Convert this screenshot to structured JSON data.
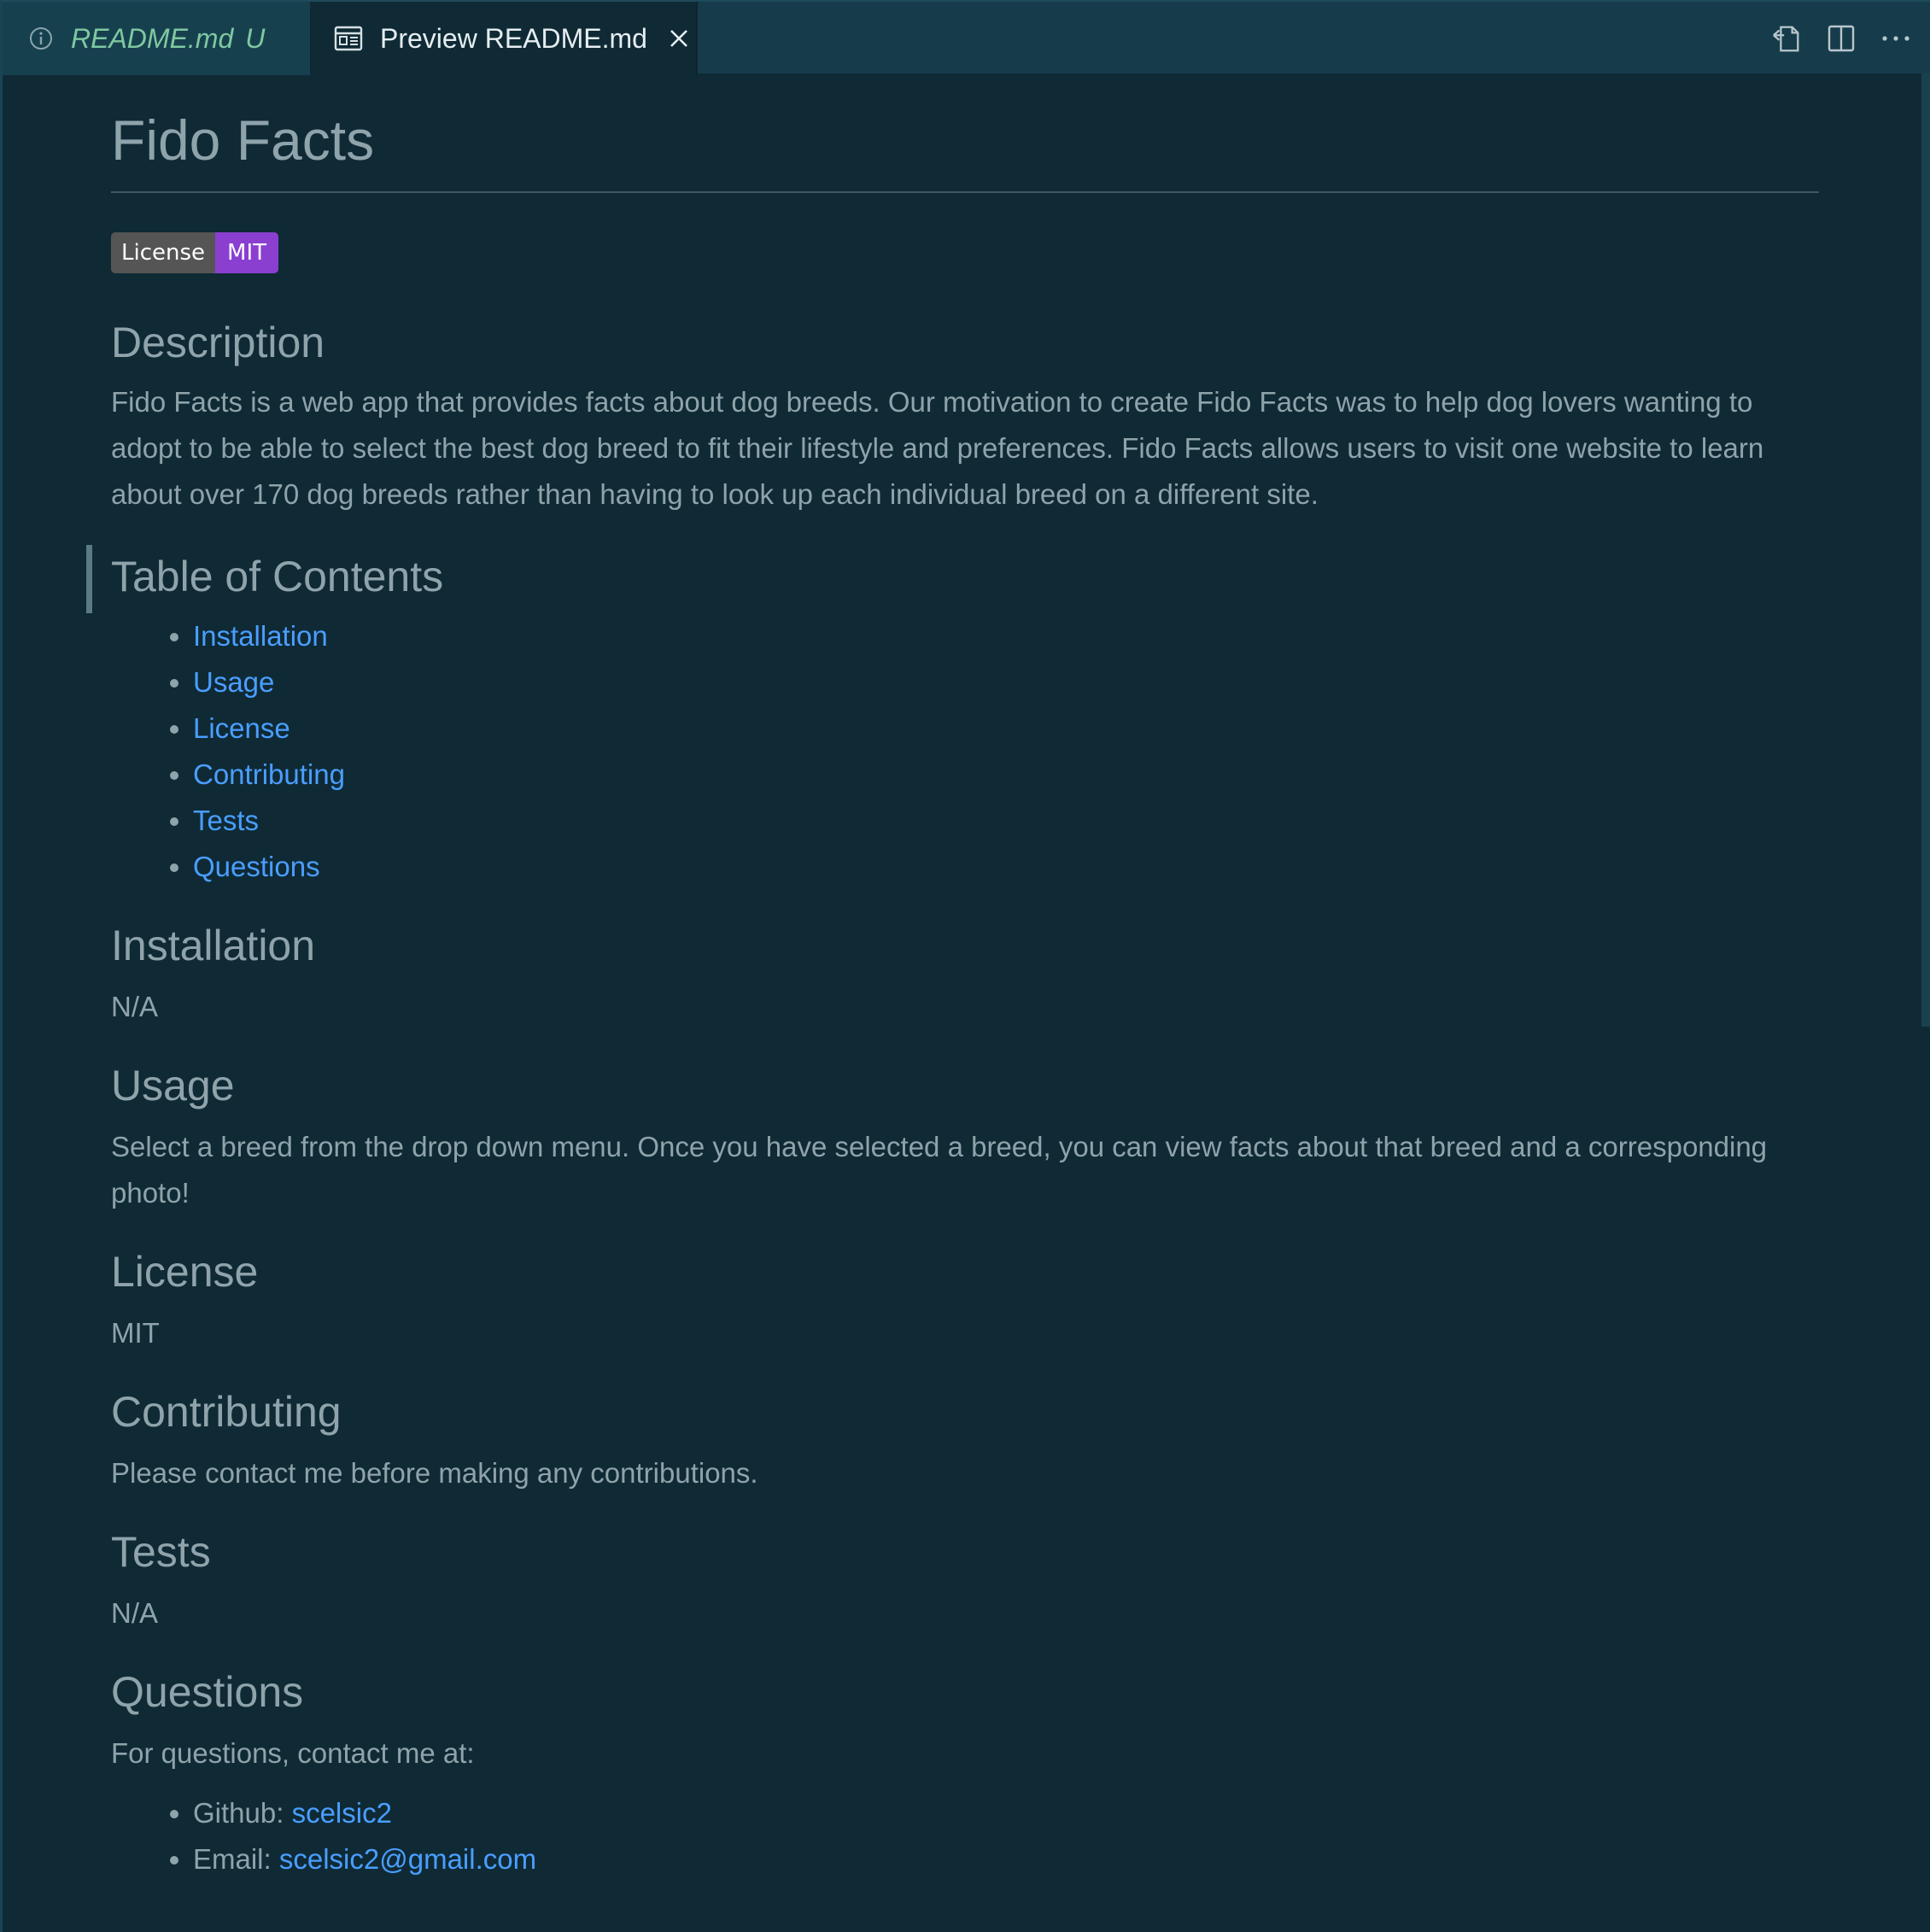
{
  "tabs": {
    "source": {
      "label": "README.md",
      "status": "U"
    },
    "preview": {
      "label": "Preview README.md"
    }
  },
  "doc": {
    "title": "Fido Facts",
    "badge": {
      "left": "License",
      "right": "MIT"
    },
    "description": {
      "heading": "Description",
      "text": "Fido Facts is a web app that provides facts about dog breeds. Our motivation to create Fido Facts was to help dog lovers wanting to adopt to be able to select the best dog breed to fit their lifestyle and preferences. Fido Facts allows users to visit one website to learn about over 170 dog breeds rather than having to look up each individual breed on a different site."
    },
    "toc": {
      "heading": "Table of Contents",
      "items": [
        "Installation",
        "Usage",
        "License",
        "Contributing",
        "Tests",
        "Questions"
      ]
    },
    "installation": {
      "heading": "Installation",
      "text": "N/A"
    },
    "usage": {
      "heading": "Usage",
      "text": "Select a breed from the drop down menu. Once you have selected a breed, you can view facts about that breed and a corresponding photo!"
    },
    "license": {
      "heading": "License",
      "text": "MIT"
    },
    "contributing": {
      "heading": "Contributing",
      "text": "Please contact me before making any contributions."
    },
    "tests": {
      "heading": "Tests",
      "text": "N/A"
    },
    "questions": {
      "heading": "Questions",
      "text": "For questions, contact me at:",
      "github_label": "Github:",
      "github_link": "scelsic2",
      "email_label": "Email:",
      "email_link": "scelsic2@gmail.com"
    }
  }
}
